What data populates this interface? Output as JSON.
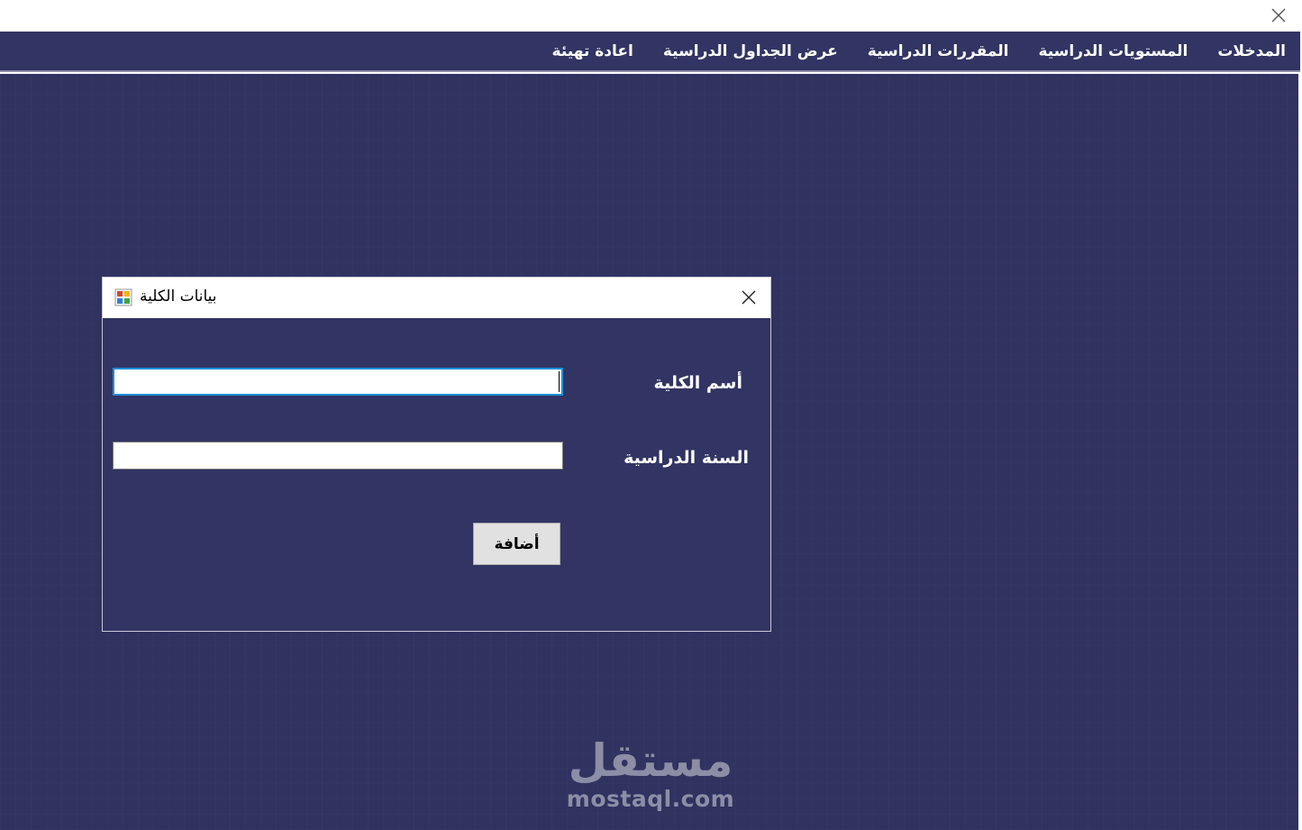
{
  "window": {
    "close_icon": "close-icon"
  },
  "menu": {
    "items": [
      {
        "label": "المدخلات"
      },
      {
        "label": "المستويات الدراسية"
      },
      {
        "label": "المقررات الدراسية"
      },
      {
        "label": "عرض الجداول الدراسية"
      },
      {
        "label": "اعادة تهيئة"
      }
    ]
  },
  "dialog": {
    "title": "بيانات الكلية",
    "icon": "form-app-icon",
    "close_icon": "close-icon",
    "fields": {
      "college_name_label": "أسم الكلية",
      "college_name_value": "",
      "academic_year_label": "السنة الدراسية",
      "academic_year_value": ""
    },
    "add_button_label": "أضافة"
  },
  "watermark": {
    "arabic": "مستقل",
    "latin": "mostaql.com"
  },
  "colors": {
    "background": "#303260",
    "menubar": "#323463",
    "focus_border": "#1e8fd8",
    "button": "#e1e1e1"
  }
}
